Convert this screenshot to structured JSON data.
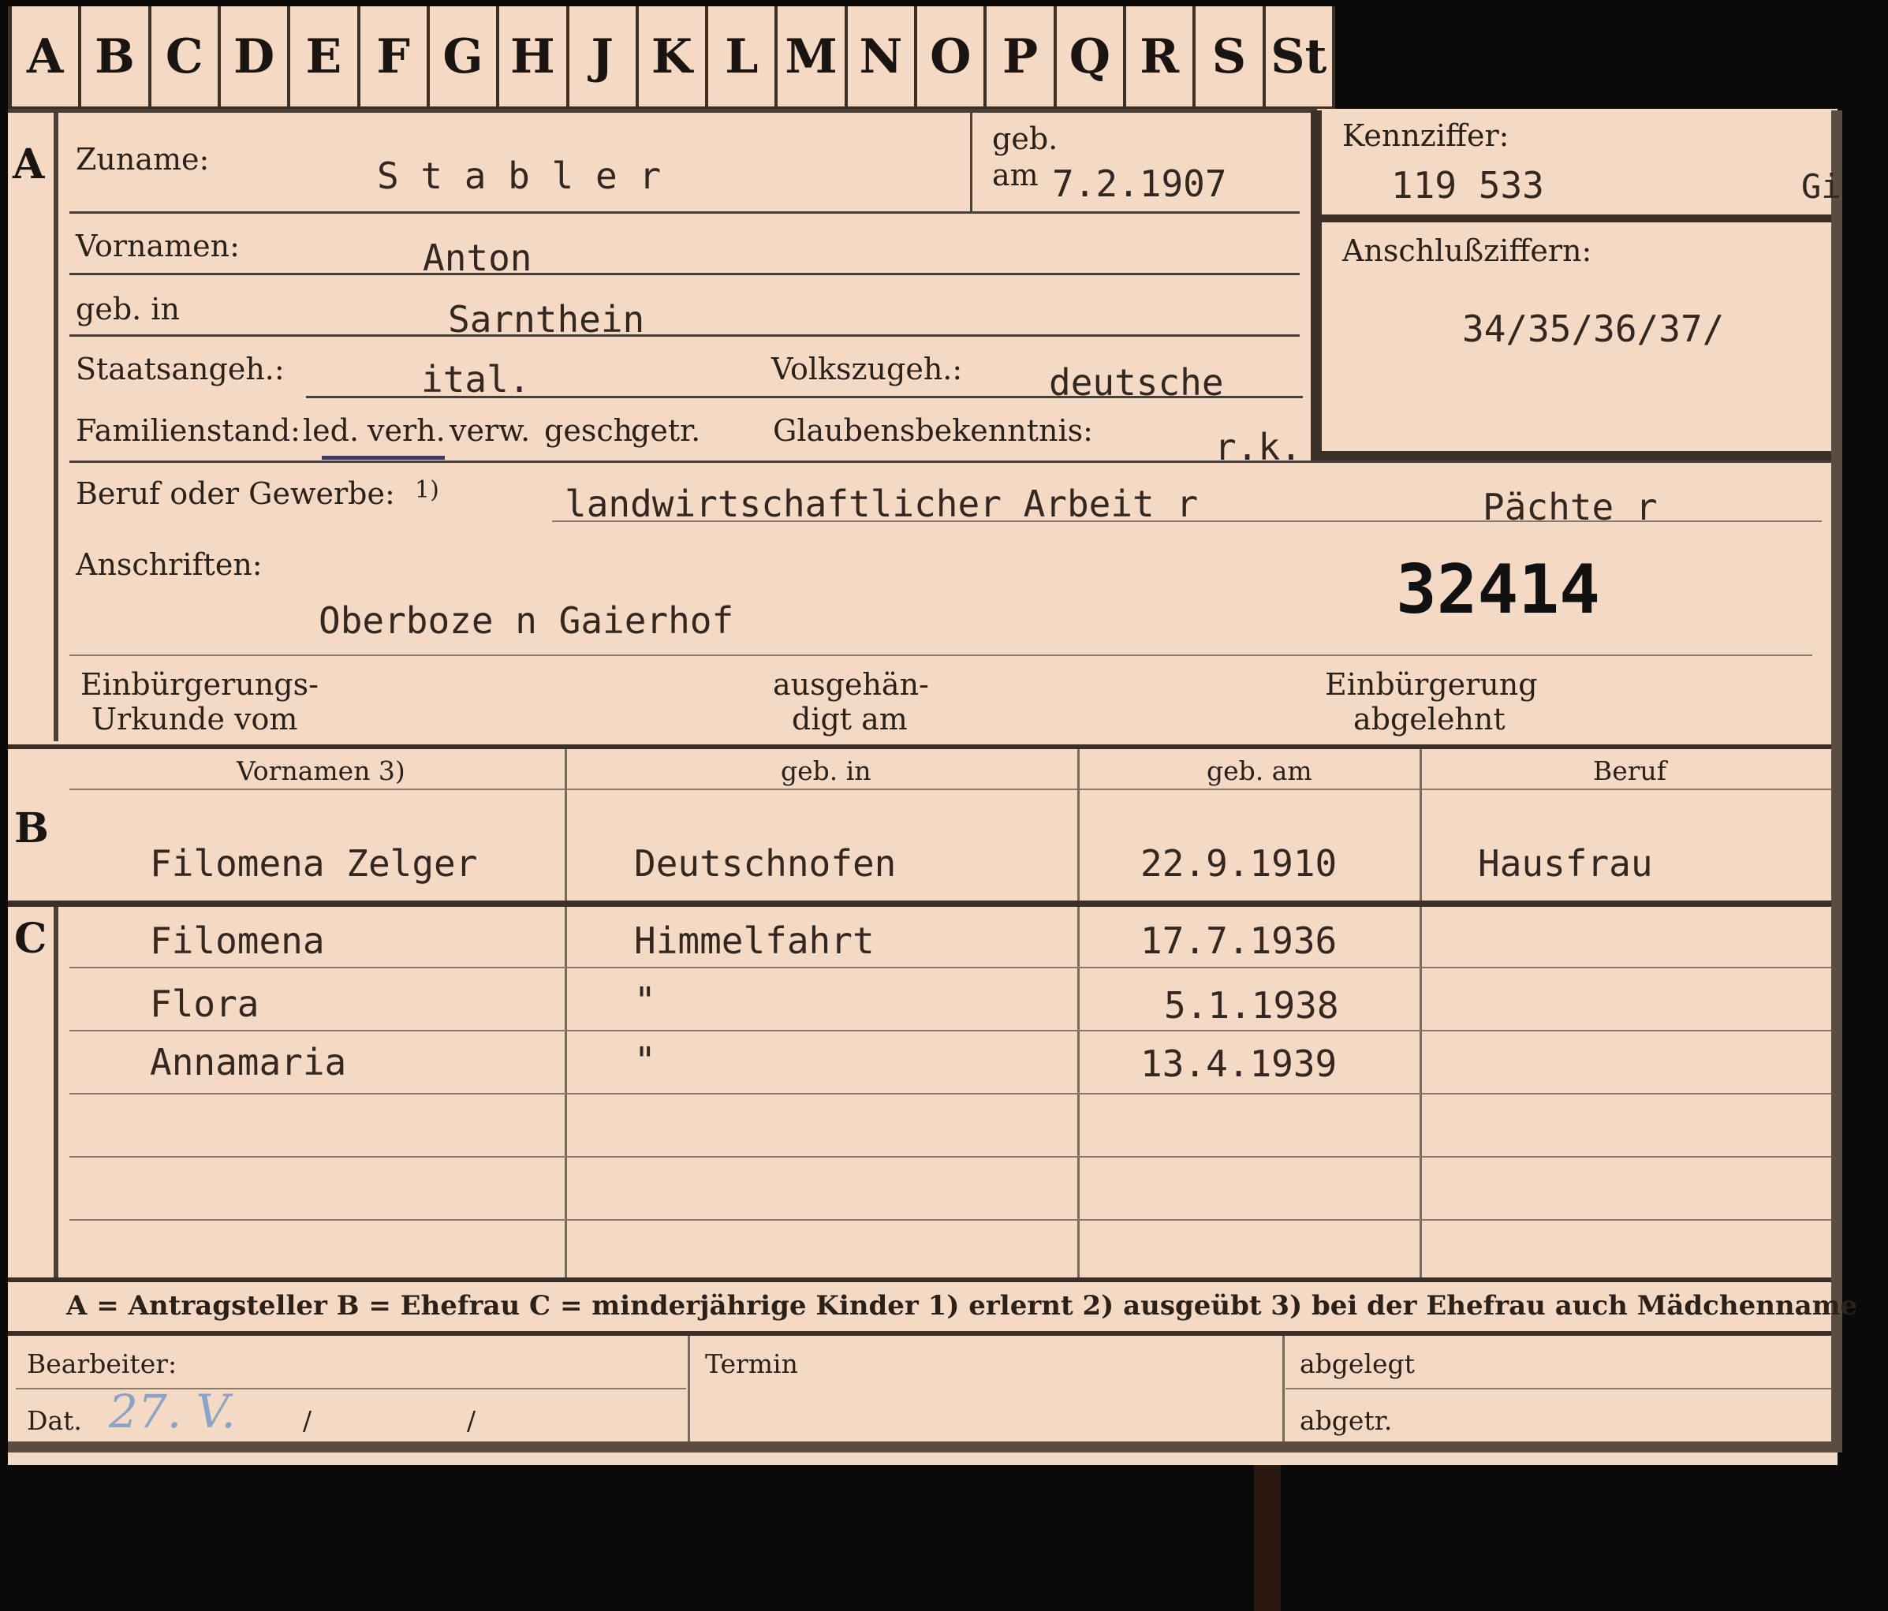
{
  "tabs": [
    "A",
    "B",
    "C",
    "D",
    "E",
    "F",
    "G",
    "H",
    "J",
    "K",
    "L",
    "M",
    "N",
    "O",
    "P",
    "Q",
    "R",
    "S",
    "St"
  ],
  "sections": {
    "a": "A",
    "b": "B",
    "c": "C"
  },
  "applicant": {
    "surname_label": "Zuname:",
    "surname": "S t a b l e r",
    "born_label_1": "geb.",
    "born_label_2": "am",
    "born_date": "7.2.1907",
    "id_label": "Kennziffer:",
    "id_number": "119 533",
    "id_suffix": "Gi",
    "firstnames_label": "Vornamen:",
    "firstnames": "Anton",
    "birthplace_label": "geb. in",
    "birthplace": "Sarnthein",
    "attach_label": "Anschlußziffern:",
    "attach_numbers": "34/35/36/37/",
    "citizenship_label": "Staatsangeh.:",
    "citizenship": "ital.",
    "ethnicity_label": "Volkszugeh.:",
    "ethnicity": "deutsche",
    "marital_label": "Familienstand:",
    "marital_options": [
      "led.",
      "verh.",
      "verw.",
      "gesch.",
      "getr."
    ],
    "religion_label": "Glaubensbekenntnis:",
    "religion": "r.k.",
    "occupation_label": "Beruf oder Gewerbe:",
    "occupation_note": "1)",
    "occupation_learned": "landwirtschaftlicher Arbeit r",
    "occupation_practiced": "Pächte r",
    "address_label": "Anschriften:",
    "address": "Oberboze n Gaierhof",
    "stamp_number": "32414",
    "naturalization_cert_1": "Einbürgerungs-",
    "naturalization_cert_2": "Urkunde vom",
    "handed_1": "ausgehän-",
    "handed_2": "digt am",
    "refused_1": "Einbürgerung",
    "refused_2": "abgelehnt"
  },
  "family_table": {
    "headers": [
      "Vornamen 3)",
      "geb. in",
      "geb. am",
      "Beruf"
    ],
    "spouse": {
      "name": "Filomena Zelger",
      "birthplace": "Deutschnofen",
      "born": "22.9.1910",
      "occupation": "Hausfrau"
    },
    "children": [
      {
        "name": "Filomena",
        "birthplace": "Himmelfahrt",
        "born": "17.7.1936"
      },
      {
        "name": "Flora",
        "birthplace": "\"",
        "born": "5.1.1938"
      },
      {
        "name": "Annamaria",
        "birthplace": "\"",
        "born": "13.4.1939"
      }
    ]
  },
  "legend": "A = Antragsteller   B = Ehefrau   C = minderjährige Kinder   1) erlernt   2) ausgeübt   3) bei der Ehefrau auch Mädchenname",
  "footer": {
    "clerk_label": "Bearbeiter:",
    "date_label": "Dat.",
    "date_value": "27. V.",
    "slash1": "/",
    "slash2": "/",
    "termin_label": "Termin",
    "filed_label": "abgelegt",
    "removed_label": "abgetr."
  }
}
